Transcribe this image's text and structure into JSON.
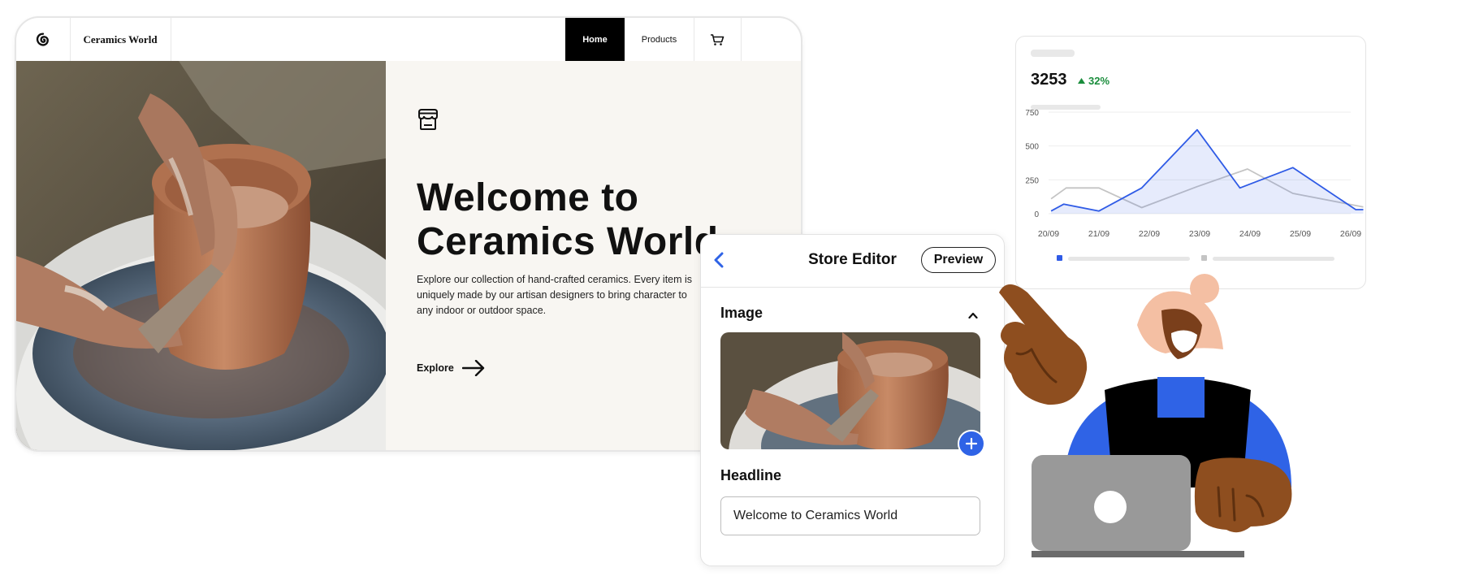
{
  "site": {
    "brand": "Ceramics World",
    "nav": {
      "home": "Home",
      "products": "Products"
    },
    "hero": {
      "title_line1": "Welcome to",
      "title_line2": "Ceramics World",
      "description": "Explore our collection of hand-crafted ceramics. Every item is uniquely made by our artisan designers to bring character to any indoor or outdoor space.",
      "cta": "Explore"
    }
  },
  "editor": {
    "title": "Store Editor",
    "preview_label": "Preview",
    "image_section": "Image",
    "headline_section": "Headline",
    "headline_value": "Welcome to Ceramics World"
  },
  "analytics": {
    "metric": "3253",
    "delta": "32%",
    "colors": {
      "primary": "#2f5be6",
      "secondary": "#c4c4c4",
      "positive": "#1a8d3c"
    }
  },
  "chart_data": {
    "type": "line",
    "categories": [
      "20/09",
      "21/09",
      "22/09",
      "23/09",
      "24/09",
      "25/09",
      "26/09"
    ],
    "yticks": [
      0,
      250,
      500,
      750
    ],
    "ylim": [
      0,
      750
    ],
    "grid": true,
    "legend": "bottom",
    "x": [
      0,
      0.3,
      1,
      1.5,
      2,
      2.5,
      3,
      3.5,
      4,
      5,
      5.5,
      6
    ],
    "series": [
      {
        "values": [
          20,
          70,
          20,
          190,
          620,
          190,
          340,
          30,
          30,
          null,
          null,
          null
        ],
        "x_index": [
          0.05,
          0.3,
          1,
          1.85,
          2.95,
          3.8,
          4.85,
          6.1,
          6.25
        ]
      },
      {
        "values": [
          110,
          190,
          190,
          45,
          200,
          330,
          150,
          50
        ],
        "x_index": [
          0.05,
          0.35,
          1,
          1.85,
          2.95,
          3.95,
          4.85,
          6.25
        ]
      }
    ]
  }
}
